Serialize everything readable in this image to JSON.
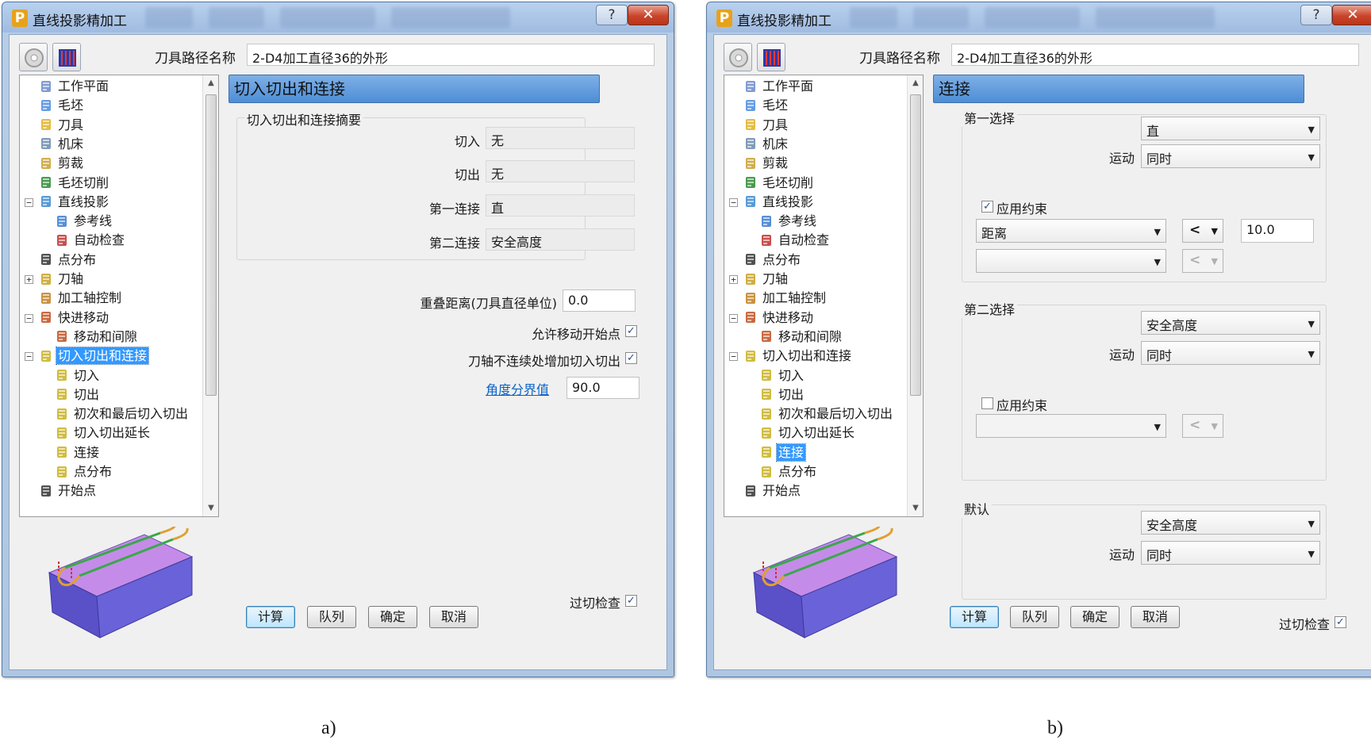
{
  "dialogs": {
    "a": {
      "title": "直线投影精加工",
      "path_label": "刀具路径名称",
      "path_value": "2-D4加工直径36的外形",
      "panel_title": "切入切出和连接",
      "summary_group": "切入切出和连接摘要",
      "summary": {
        "lead_in_label": "切入",
        "lead_in_value": "无",
        "lead_out_label": "切出",
        "lead_out_value": "无",
        "first_link_label": "第一连接",
        "first_link_value": "直",
        "second_link_label": "第二连接",
        "second_link_value": "安全高度"
      },
      "overlap_label": "重叠距离(刀具直径单位)",
      "overlap_value": "0.0",
      "allow_move_start_label": "允许移动开始点",
      "add_lead_label": "刀轴不连续处增加切入切出",
      "angle_link": "角度分界值",
      "angle_value": "90.0",
      "gouge_check_label": "过切检查"
    },
    "b": {
      "title": "直线投影精加工",
      "path_label": "刀具路径名称",
      "path_value": "2-D4加工直径36的外形",
      "panel_title": "连接",
      "first_choice": {
        "group": "第一选择",
        "type": "直",
        "motion_label": "运动",
        "motion": "同时",
        "apply_constraint_label": "应用约束",
        "constraint_type": "距离",
        "constraint_op": "<",
        "constraint_value": "10.0",
        "second_op": "<"
      },
      "second_choice": {
        "group": "第二选择",
        "type": "安全高度",
        "motion_label": "运动",
        "motion": "同时",
        "apply_constraint_label": "应用约束",
        "op": "<"
      },
      "default": {
        "group": "默认",
        "type": "安全高度",
        "motion_label": "运动",
        "motion": "同时"
      },
      "gouge_check_label": "过切检查"
    }
  },
  "tree_items": [
    {
      "label": "工作平面",
      "icon": "workplane-icon"
    },
    {
      "label": "毛坯",
      "icon": "block-icon"
    },
    {
      "label": "刀具",
      "icon": "tool-icon"
    },
    {
      "label": "机床",
      "icon": "machine-icon"
    },
    {
      "label": "剪裁",
      "icon": "trim-icon"
    },
    {
      "label": "毛坯切削",
      "icon": "stock-cut-icon"
    },
    {
      "label": "直线投影",
      "icon": "line-projection-icon"
    },
    {
      "label": "参考线",
      "icon": "pattern-icon"
    },
    {
      "label": "自动检查",
      "icon": "auto-check-icon"
    },
    {
      "label": "点分布",
      "icon": "point-distribution-icon"
    },
    {
      "label": "刀轴",
      "icon": "tool-axis-icon"
    },
    {
      "label": "加工轴控制",
      "icon": "axis-control-icon"
    },
    {
      "label": "快进移动",
      "icon": "rapid-move-icon"
    },
    {
      "label": "移动和间隙",
      "icon": "moves-clearance-icon"
    },
    {
      "label": "切入切出和连接",
      "icon": "leads-links-icon"
    },
    {
      "label": "切入",
      "icon": "lead-in-icon"
    },
    {
      "label": "切出",
      "icon": "lead-out-icon"
    },
    {
      "label": "初次和最后切入切出",
      "icon": "first-last-lead-icon"
    },
    {
      "label": "切入切出延长",
      "icon": "lead-extension-icon"
    },
    {
      "label": "连接",
      "icon": "links-icon"
    },
    {
      "label": "点分布",
      "icon": "point-distribution-icon"
    },
    {
      "label": "开始点",
      "icon": "start-point-icon"
    }
  ],
  "buttons": {
    "calculate": "计算",
    "queue": "队列",
    "accept": "确定",
    "cancel": "取消"
  },
  "window_buttons": {
    "help": "?",
    "close": "✕"
  },
  "captions": {
    "a": "a)",
    "b": "b)"
  },
  "colors": {
    "selection": "#3399ff",
    "header": "#4d8ed6",
    "link": "#0b63c9",
    "block_top": "#c48ce8",
    "block_side": "#5a50c8"
  }
}
